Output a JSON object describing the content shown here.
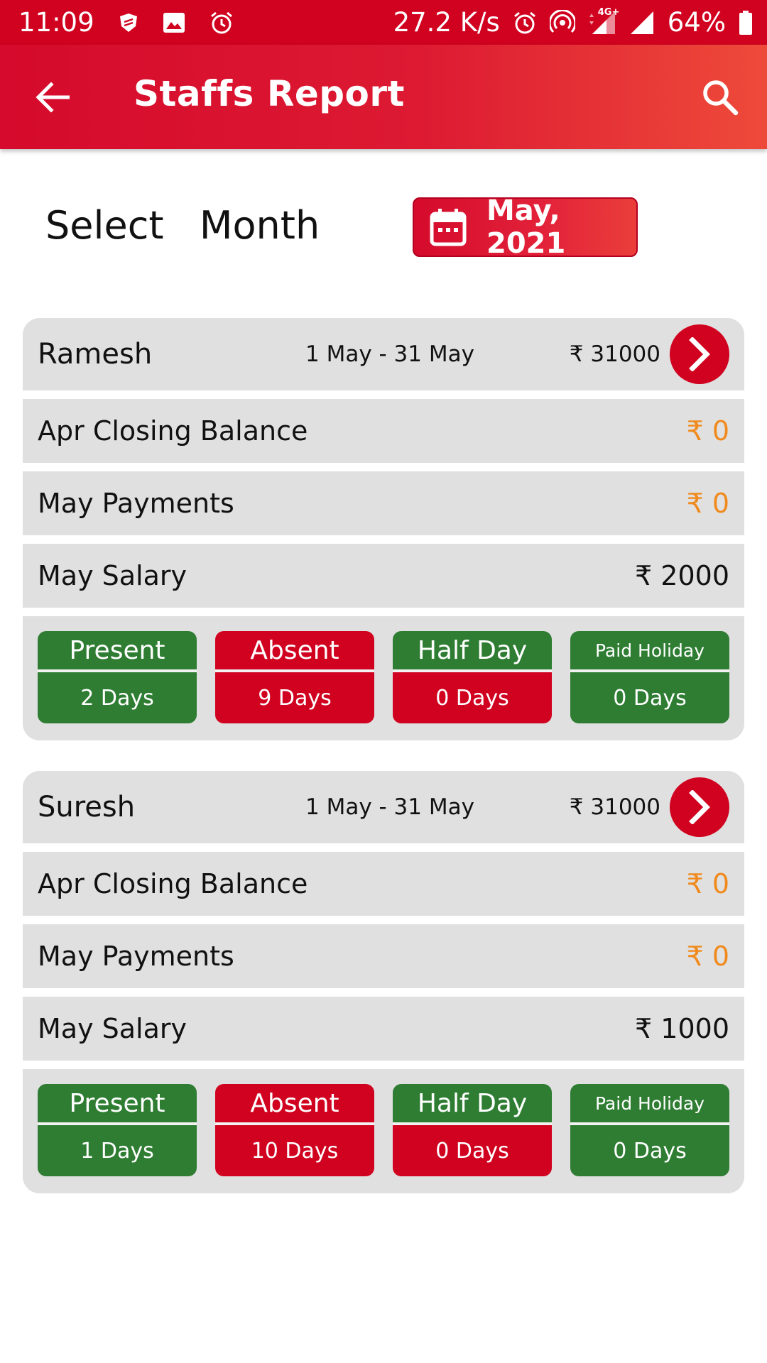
{
  "status_bar": {
    "time": "11:09",
    "net_speed": "27.2 K/s",
    "network_type": "4G+",
    "battery": "64%",
    "icons": [
      "shield-icon",
      "image-icon",
      "alarm-icon",
      "alarm-icon",
      "hotspot-icon",
      "signal-icon",
      "signal-icon",
      "battery-icon"
    ]
  },
  "app_bar": {
    "title": "Staffs Report",
    "icons": [
      "back-arrow-icon",
      "search-icon"
    ]
  },
  "month_select": {
    "label": "Select  Month",
    "value": "May, 2021"
  },
  "colors": {
    "primary_red": "#d0021f",
    "green": "#2e7d32",
    "orange": "#f08a1c",
    "card_bg": "#e0e0e0"
  },
  "staff": [
    {
      "name": "Ramesh",
      "period": "1 May - 31 May",
      "amount": "₹ 31000",
      "closing_label": "Apr Closing Balance",
      "closing_value": "₹ 0",
      "payments_label": "May Payments",
      "payments_value": "₹ 0",
      "salary_label": "May Salary",
      "salary_value": "₹ 2000",
      "attendance": [
        {
          "label": "Present",
          "value": "2 Days"
        },
        {
          "label": "Absent",
          "value": "9 Days"
        },
        {
          "label": "Half Day",
          "value": "0 Days"
        },
        {
          "label": "Paid Holiday",
          "value": "0 Days"
        }
      ]
    },
    {
      "name": "Suresh",
      "period": "1 May - 31 May",
      "amount": "₹ 31000",
      "closing_label": "Apr Closing Balance",
      "closing_value": "₹ 0",
      "payments_label": "May Payments",
      "payments_value": "₹ 0",
      "salary_label": "May Salary",
      "salary_value": "₹ 1000",
      "attendance": [
        {
          "label": "Present",
          "value": "1 Days"
        },
        {
          "label": "Absent",
          "value": "10 Days"
        },
        {
          "label": "Half Day",
          "value": "0 Days"
        },
        {
          "label": "Paid Holiday",
          "value": "0 Days"
        }
      ]
    }
  ]
}
